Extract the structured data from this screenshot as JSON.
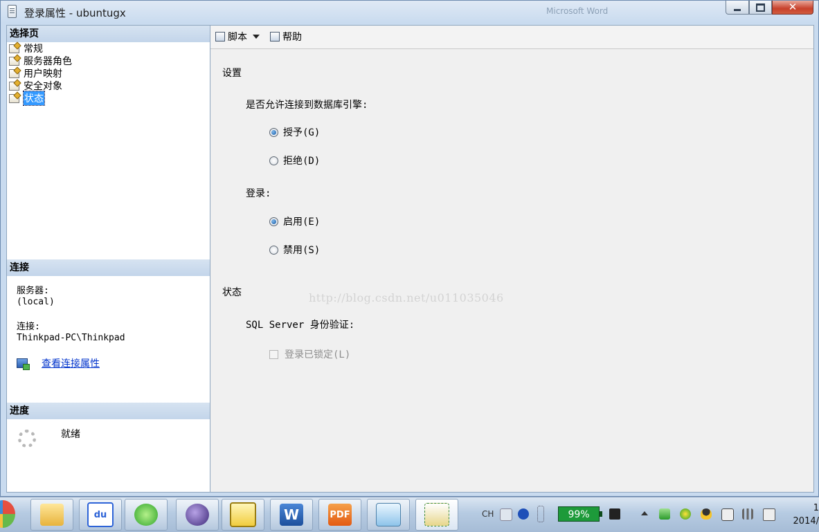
{
  "window": {
    "title": "登录属性 - ubuntugx",
    "background_hint": "Microsoft Word"
  },
  "left_pane": {
    "select_page_header": "选择页",
    "pages": [
      {
        "label": "常规",
        "selected": false
      },
      {
        "label": "服务器角色",
        "selected": false
      },
      {
        "label": "用户映射",
        "selected": false
      },
      {
        "label": "安全对象",
        "selected": false
      },
      {
        "label": "状态",
        "selected": true
      }
    ],
    "connection": {
      "header": "连接",
      "server_label": "服务器:",
      "server_value": "(local)",
      "connection_label": "连接:",
      "connection_value": "Thinkpad-PC\\Thinkpad",
      "view_properties_link": "查看连接属性"
    },
    "progress": {
      "header": "进度",
      "status": "就绪"
    }
  },
  "toolbar": {
    "script_label": "脚本",
    "help_label": "帮助"
  },
  "form": {
    "settings_heading": "设置",
    "permission_question": "是否允许连接到数据库引擎:",
    "grant_label": "授予(G)",
    "deny_label": "拒绝(D)",
    "permission_selected": "grant",
    "login_heading": "登录:",
    "enable_label": "启用(E)",
    "disable_label": "禁用(S)",
    "login_selected": "enable",
    "status_heading": "状态",
    "sql_auth_label": "SQL Server 身份验证:",
    "locked_label": "登录已锁定(L)",
    "locked_checked": false,
    "locked_enabled": false,
    "watermark": "http://blog.csdn.net/u011035046"
  },
  "taskbar": {
    "apps": [
      {
        "name": "file-explorer-icon"
      },
      {
        "name": "baidu-icon",
        "text": "du"
      },
      {
        "name": "ie-browser-icon"
      },
      {
        "name": "eclipse-icon"
      },
      {
        "name": "snipping-tool-icon"
      },
      {
        "name": "word-icon",
        "text": "W"
      },
      {
        "name": "pdf-icon",
        "text": "PDF"
      },
      {
        "name": "notepad-icon"
      },
      {
        "name": "sql-management-studio-icon"
      }
    ],
    "language": "CH",
    "battery_percent": "99%",
    "clock_line1": "1",
    "clock_line2": "2014/"
  },
  "colors": {
    "selection": "#3399ff",
    "link": "#0033cc",
    "section_header": "#c3d5ea"
  }
}
